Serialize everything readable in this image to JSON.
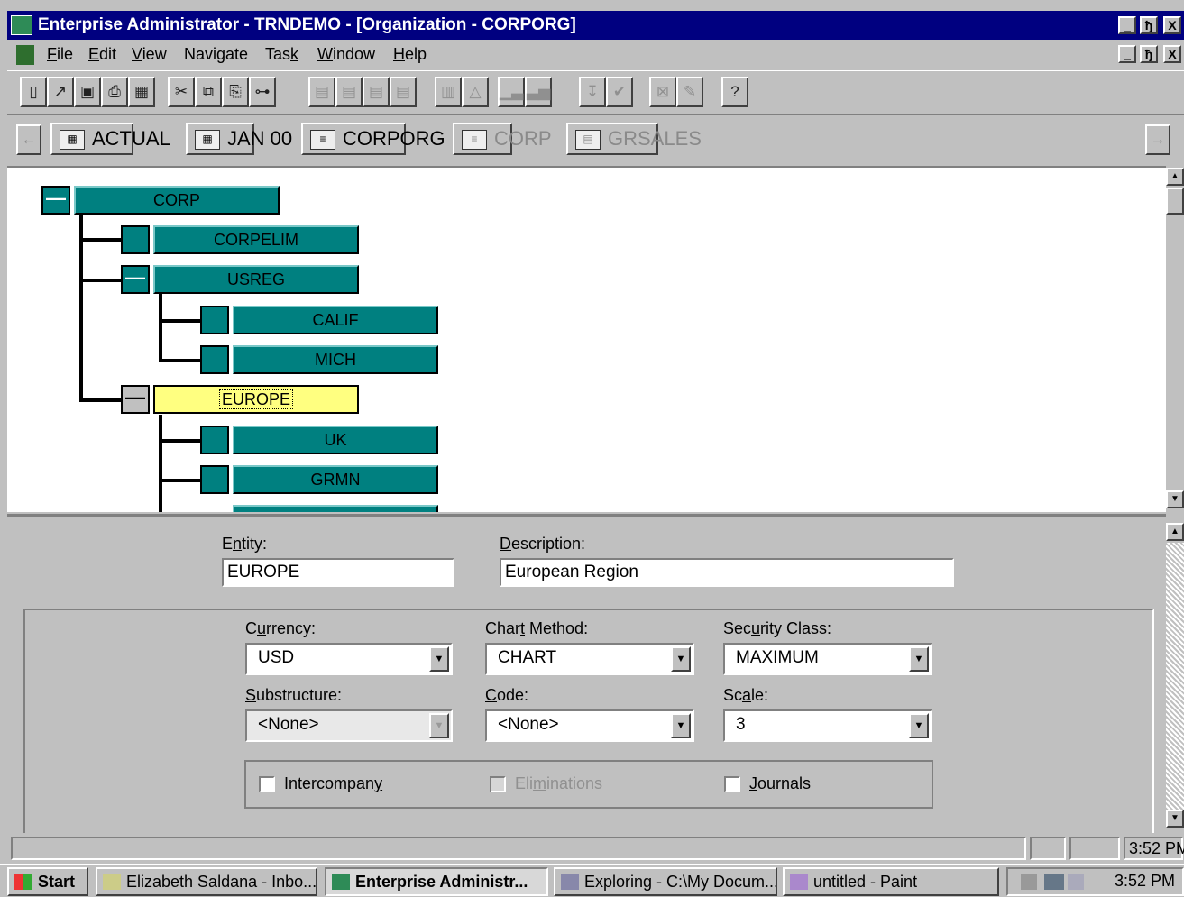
{
  "window": {
    "title": "Enterprise Administrator - TRNDEMO - [Organization - CORPORG]",
    "controls": {
      "minimize": "_",
      "restore": "ђ",
      "close": "X"
    }
  },
  "menu": {
    "items": [
      {
        "accel": "F",
        "rest": "ile"
      },
      {
        "accel": "E",
        "rest": "dit"
      },
      {
        "accel": "V",
        "rest": "iew"
      },
      {
        "pre": "Navigate"
      },
      {
        "pre": "Tas",
        "accel": "k",
        "rest": ""
      },
      {
        "accel": "W",
        "rest": "indow"
      },
      {
        "accel": "H",
        "rest": "elp"
      }
    ]
  },
  "toolbar": {
    "buttons": [
      {
        "name": "new-icon",
        "glyph": "▯"
      },
      {
        "name": "open-icon",
        "glyph": "↗"
      },
      {
        "name": "save-icon",
        "glyph": "▣"
      },
      {
        "name": "print-icon",
        "glyph": "⎙"
      },
      {
        "name": "calculator-icon",
        "glyph": "▦"
      },
      {
        "name": "cut-icon",
        "glyph": "✂"
      },
      {
        "name": "copy-icon",
        "glyph": "⧉"
      },
      {
        "name": "paste-icon",
        "glyph": "⎘"
      },
      {
        "name": "hierarchy-icon",
        "glyph": "⊶"
      },
      {
        "name": "tool-a-icon",
        "glyph": "▤"
      },
      {
        "name": "tool-b-icon",
        "glyph": "▤"
      },
      {
        "name": "tool-c-icon",
        "glyph": "▤"
      },
      {
        "name": "tool-d-icon",
        "glyph": "▤"
      },
      {
        "name": "chart-a-icon",
        "glyph": "▥"
      },
      {
        "name": "chart-b-icon",
        "glyph": "△"
      },
      {
        "name": "bar-chart-a-icon",
        "glyph": "▁▃"
      },
      {
        "name": "bar-chart-b-icon",
        "glyph": "▃▅"
      },
      {
        "name": "sort-icon",
        "glyph": "↧"
      },
      {
        "name": "check-icon",
        "glyph": "✔"
      },
      {
        "name": "excel-icon",
        "glyph": "⊠"
      },
      {
        "name": "edit-icon",
        "glyph": "✎"
      },
      {
        "name": "help-icon",
        "glyph": "?"
      }
    ]
  },
  "pov": {
    "back_glyph": "←",
    "forward_glyph": "→",
    "items": [
      {
        "label": "ACTUAL",
        "icon_glyph": "▦",
        "enabled": true
      },
      {
        "label": "JAN 00",
        "icon_glyph": "▦",
        "enabled": true
      },
      {
        "label": "CORPORG",
        "icon_glyph": "≡",
        "enabled": true
      },
      {
        "label": "CORP",
        "icon_glyph": "≡",
        "enabled": false
      },
      {
        "label": "GRSALES",
        "icon_glyph": "▤",
        "enabled": false
      }
    ]
  },
  "tree": {
    "nodes": [
      {
        "label": "CORP",
        "toggle": "—",
        "selected": false
      },
      {
        "label": "CORPELIM",
        "toggle": "",
        "selected": false
      },
      {
        "label": "USREG",
        "toggle": "—",
        "selected": false
      },
      {
        "label": "CALIF",
        "toggle": "",
        "selected": false
      },
      {
        "label": "MICH",
        "toggle": "",
        "selected": false
      },
      {
        "label": "EUROPE",
        "toggle": "—",
        "selected": true
      },
      {
        "label": "UK",
        "toggle": "",
        "selected": false
      },
      {
        "label": "GRMN",
        "toggle": "",
        "selected": false
      }
    ]
  },
  "details": {
    "entity_label_pre": "E",
    "entity_label_accel": "n",
    "entity_label_rest": "tity:",
    "entity_value": "EUROPE",
    "description_label_accel": "D",
    "description_label_rest": "escription:",
    "description_value": "European Region",
    "currency_label_pre": "C",
    "currency_label_accel": "u",
    "currency_label_rest": "rrency:",
    "currency_value": "USD",
    "chart_method_label_pre": "Char",
    "chart_method_label_accel": "t",
    "chart_method_label_rest": " Method:",
    "chart_method_value": "CHART",
    "security_label_pre": "Sec",
    "security_label_accel": "u",
    "security_label_rest": "rity Class:",
    "security_value": "MAXIMUM",
    "substructure_label_accel": "S",
    "substructure_label_rest": "ubstructure:",
    "substructure_value": "<None>",
    "code_label_accel": "C",
    "code_label_rest": "ode:",
    "code_value": "<None>",
    "scale_label_pre": "Sc",
    "scale_label_accel": "a",
    "scale_label_rest": "le:",
    "scale_value": "3",
    "intercompany_label_pre": "Intercompan",
    "intercompany_label_accel": "y",
    "eliminations_label_pre": "Eli",
    "eliminations_label_accel": "m",
    "eliminations_label_rest": "inations",
    "journals_label_accel": "J",
    "journals_label_rest": "ournals",
    "arrow_glyph": "▼"
  },
  "status": {
    "time": "3:52 PM"
  },
  "taskbar": {
    "start_label": "Start",
    "buttons": [
      {
        "label": "Elizabeth Saldana - Inbo...",
        "active": false
      },
      {
        "label": "Enterprise Administr...",
        "active": true
      },
      {
        "label": "Exploring - C:\\My Docum...",
        "active": false
      },
      {
        "label": "untitled - Paint",
        "active": false
      }
    ],
    "clock": "3:52 PM"
  },
  "colors": {
    "title_bar": "#000080",
    "tree_node": "#008080",
    "tree_selected": "#ffff80",
    "face": "#c0c0c0"
  }
}
